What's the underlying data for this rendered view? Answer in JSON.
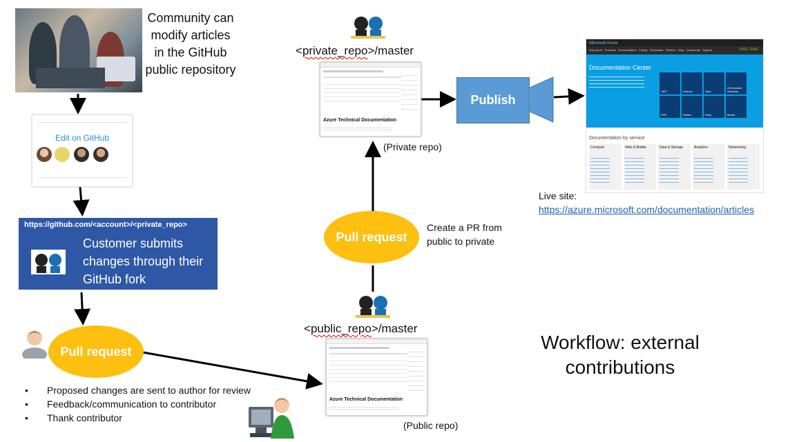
{
  "community_text": "Community can modify articles in the GitHub public repository",
  "edit_card": {
    "link_text": "Edit on GitHub"
  },
  "fork_box": {
    "url": "https://github.com/<account>/<private_repo>",
    "text": "Customer submits changes through their GitHub fork"
  },
  "pull_request_label": "Pull request",
  "bullets": [
    "Proposed changes are sent to author for review",
    "Feedback/communication to contributor",
    "Thank contributor"
  ],
  "private_repo": {
    "title_prefix": "<",
    "title_name": "private_repo",
    "title_suffix": ">/master",
    "caption": "(Private repo)",
    "doc_title": "Azure Technical Documentation"
  },
  "public_repo": {
    "title_prefix": "<",
    "title_name": "public_repo",
    "title_suffix": ">/master",
    "caption": "(Public repo)",
    "doc_title": "Azure Technical Documentation"
  },
  "create_pr_text": "Create a PR from public to private",
  "publish_label": "Publish",
  "live_site": {
    "label": "Live site:",
    "url": "https://azure.microsoft.com/documentation/articles"
  },
  "azure_page": {
    "brand": "Microsoft Azure",
    "nav": "Why Azure   Products   Documentation   Pricing   Downloads   Partners   Blog   Community   Support",
    "trial": "FREE TRIAL",
    "heading": "Documentation Center",
    "tiles": [
      ".NET",
      "Node.js",
      "Java",
      "iOS Android Windows",
      "PHP",
      "Python",
      "Ruby",
      "Media"
    ],
    "by_service": "Documentation by service",
    "columns": [
      "Compute",
      "Web & Mobile",
      "Data & Storage",
      "Analytics",
      "Networking"
    ]
  },
  "workflow_title": "Workflow: external contributions",
  "colors": {
    "blue_box": "#2e58a6",
    "oval": "#fdbf10",
    "publish": "#5b9bd5",
    "link": "#1f5fb4",
    "azure_blue": "#0a9ee3"
  }
}
